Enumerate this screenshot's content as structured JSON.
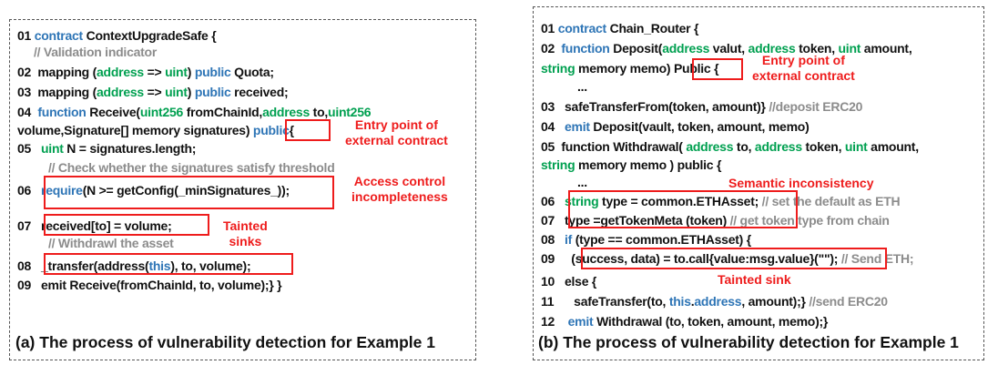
{
  "panel_a": {
    "lines": {
      "l01": {
        "num": "01",
        "kw": "contract",
        "rest": "ContextUpgradeSafe {"
      },
      "c1": "// Validation indicator",
      "l02": {
        "num": "02",
        "a": "mapping (",
        "t1": "address",
        "arrow": " => ",
        "t2": "uint",
        "b": ") ",
        "pub": "public",
        "c": " Quota;"
      },
      "l03": {
        "num": "03",
        "a": "mapping (",
        "t1": "address",
        "arrow": " => ",
        "t2": "uint",
        "b": ") ",
        "pub": "public",
        "c": " received;"
      },
      "l04": {
        "num": "04",
        "kw": "function",
        "a": " Receive(",
        "t1": "uint256",
        "b": " fromChainId,",
        "t2": "address",
        "c": " to,",
        "t3": "uint256"
      },
      "l04b": {
        "a": "volume,Signature[] memory signatures) ",
        "pub": "public",
        "brace": "{"
      },
      "l05": {
        "num": "05",
        "t": "uint",
        "rest": " N = signatures.length;"
      },
      "c2": "// Check whether the signatures satisfy threshold",
      "l06": {
        "num": "06",
        "kw": "require",
        "rest": "(N >= getConfig(_minSignatures_));"
      },
      "l07": {
        "num": "07",
        "rest": "received[to] = volume;"
      },
      "c3": "// Withdrawl the asset",
      "l08": {
        "num": "08",
        "a": "_transfer(address(",
        "kw": "this",
        "b": "), to, volume);"
      },
      "l09": {
        "num": "09",
        "rest": "emit Receive(fromChainId, to, volume);}    }"
      }
    },
    "annotations": {
      "entry_1": "Entry point of",
      "entry_2": "external contract",
      "access_1": "Access control",
      "access_2": "incompleteness",
      "tainted_1": "Tainted",
      "tainted_2": "sinks"
    },
    "caption": "(a) The process of vulnerability detection for Example 1"
  },
  "panel_b": {
    "lines": {
      "l01": {
        "num": "01",
        "kw": "contract",
        "rest": "Chain_Router  {"
      },
      "l02": {
        "num": "02",
        "kw": "function",
        "a": " Deposit(",
        "t1": "address",
        "b": " valut, ",
        "t2": "address",
        "c": " token, ",
        "t3": "uint",
        "d": " amount,"
      },
      "l02b": {
        "t": "string",
        "a": " memory memo) ",
        "pub": "Public",
        "b": " {"
      },
      "dots1": "...",
      "l03": {
        "num": "03",
        "rest": "safeTransferFrom(token, amount)}",
        "cm": "  //deposit ERC20"
      },
      "l04": {
        "num": "04",
        "kw": "emit",
        "rest": " Deposit(vault, token, amount, memo)"
      },
      "l05": {
        "num": "05",
        "a": "function Withdrawal( ",
        "t1": "address",
        "b": " to, ",
        "t2": "address",
        "c": " token, ",
        "t3": "uint",
        "d": " amount,"
      },
      "l05b": {
        "t": "string",
        "a": " memory memo ) ",
        "pub": "public",
        "b": " {"
      },
      "dots2": "...",
      "l06": {
        "num": "06",
        "t": "string",
        "rest": " type = common.ETHAsset;",
        "cm": " // set the default as ETH"
      },
      "l07": {
        "num": "07",
        "rest": "type =getTokenMeta (token)",
        "cm": "  // get token type from chain"
      },
      "l08": {
        "num": "08",
        "kw": "if",
        "rest": " (type == common.ETHAsset) {"
      },
      "l09": {
        "num": "09",
        "a": "(success, data) = to.call{value:msg.value}(\"\");",
        "cm": " // Send ETH;"
      },
      "l10": {
        "num": "10",
        "rest": "else {"
      },
      "l11": {
        "num": "11",
        "a": "safeTransfer(to, ",
        "kw": "this",
        "b": ".",
        "kw2": "address",
        "c": ", amount);}",
        "cm": "  //send ERC20"
      },
      "l12": {
        "num": "12",
        "kw": "emit",
        "rest": " Withdrawal (to, token, amount, memo);}"
      }
    },
    "annotations": {
      "entry_1": "Entry point of",
      "entry_2": "external contract",
      "semantic": "Semantic inconsistency",
      "tainted": "Tainted sink"
    },
    "caption": "(b) The process of vulnerability detection for Example 1"
  },
  "colors": {
    "keyword_blue": "#2e75b6",
    "type_green": "#00a050",
    "comment_gray": "#8c8c8c",
    "highlight_red": "#ee1c1c"
  }
}
